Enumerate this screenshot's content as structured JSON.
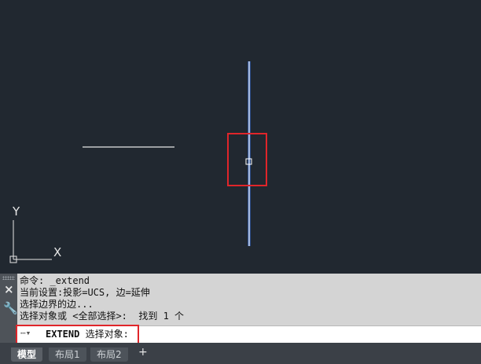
{
  "canvas": {
    "background": "#212830",
    "ucs_y_label": "Y",
    "ucs_x_label": "X",
    "line_color": "#e6e6e6",
    "selected_line_color": "#8fb6ff",
    "highlight_color": "#e0252a"
  },
  "command_line": {
    "close_icon": "×",
    "wrench_icon": "🔧",
    "history": [
      "命令: _extend",
      "当前设置:投影=UCS, 边=延伸",
      "选择边界的边...",
      "选择对象或 <全部选择>:  找到 1 个"
    ],
    "prompt_command": "EXTEND",
    "prompt_text": " 选择对象:"
  },
  "layout_tabs": [
    "模型",
    "布局1",
    "布局2"
  ],
  "add_tab_label": "+"
}
